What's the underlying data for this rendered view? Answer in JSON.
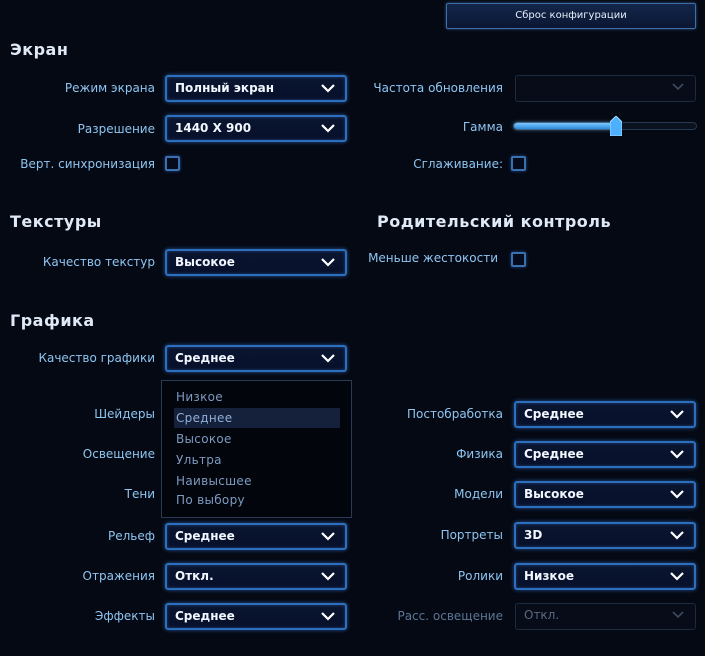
{
  "top": {
    "reset_button": "Сброс конфигурации"
  },
  "screen": {
    "title": "Экран",
    "display_mode": {
      "label": "Режим экрана",
      "value": "Полный экран"
    },
    "refresh_rate": {
      "label": "Частота обновления",
      "value": ""
    },
    "resolution": {
      "label": "Разрешение",
      "value": "1440 X 900"
    },
    "gamma": {
      "label": "Гамма",
      "value_fraction": 0.56
    },
    "vsync": {
      "label": "Верт. синхронизация",
      "checked": false
    },
    "antialiasing": {
      "label": "Сглаживание:",
      "checked": false
    }
  },
  "textures": {
    "title": "Текстуры",
    "quality": {
      "label": "Качество текстур",
      "value": "Высокое"
    }
  },
  "parental": {
    "title": "Родительский контроль",
    "less_violence": {
      "label": "Меньше жестокости",
      "checked": false
    }
  },
  "graphics": {
    "title": "Графика",
    "quality": {
      "label": "Качество графики",
      "value": "Среднее"
    },
    "dropdown_options": [
      "Низкое",
      "Среднее",
      "Высокое",
      "Ультра",
      "Наивысшее",
      "По выбору"
    ],
    "dropdown_selected_index": 1,
    "shaders": {
      "label": "Шейдеры"
    },
    "lighting": {
      "label": "Освещение"
    },
    "shadows": {
      "label": "Тени"
    },
    "terrain": {
      "label": "Рельеф",
      "value": "Среднее"
    },
    "reflections": {
      "label": "Отражения",
      "value": "Откл."
    },
    "effects": {
      "label": "Эффекты",
      "value": "Среднее"
    },
    "post_processing": {
      "label": "Постобработка",
      "value": "Среднее"
    },
    "physics": {
      "label": "Физика",
      "value": "Среднее"
    },
    "models": {
      "label": "Модели",
      "value": "Высокое"
    },
    "portraits": {
      "label": "Портреты",
      "value": "3D"
    },
    "cinematics": {
      "label": "Ролики",
      "value": "Низкое"
    },
    "indirect_lighting": {
      "label": "Расс. освещение",
      "value": "Откл."
    }
  }
}
